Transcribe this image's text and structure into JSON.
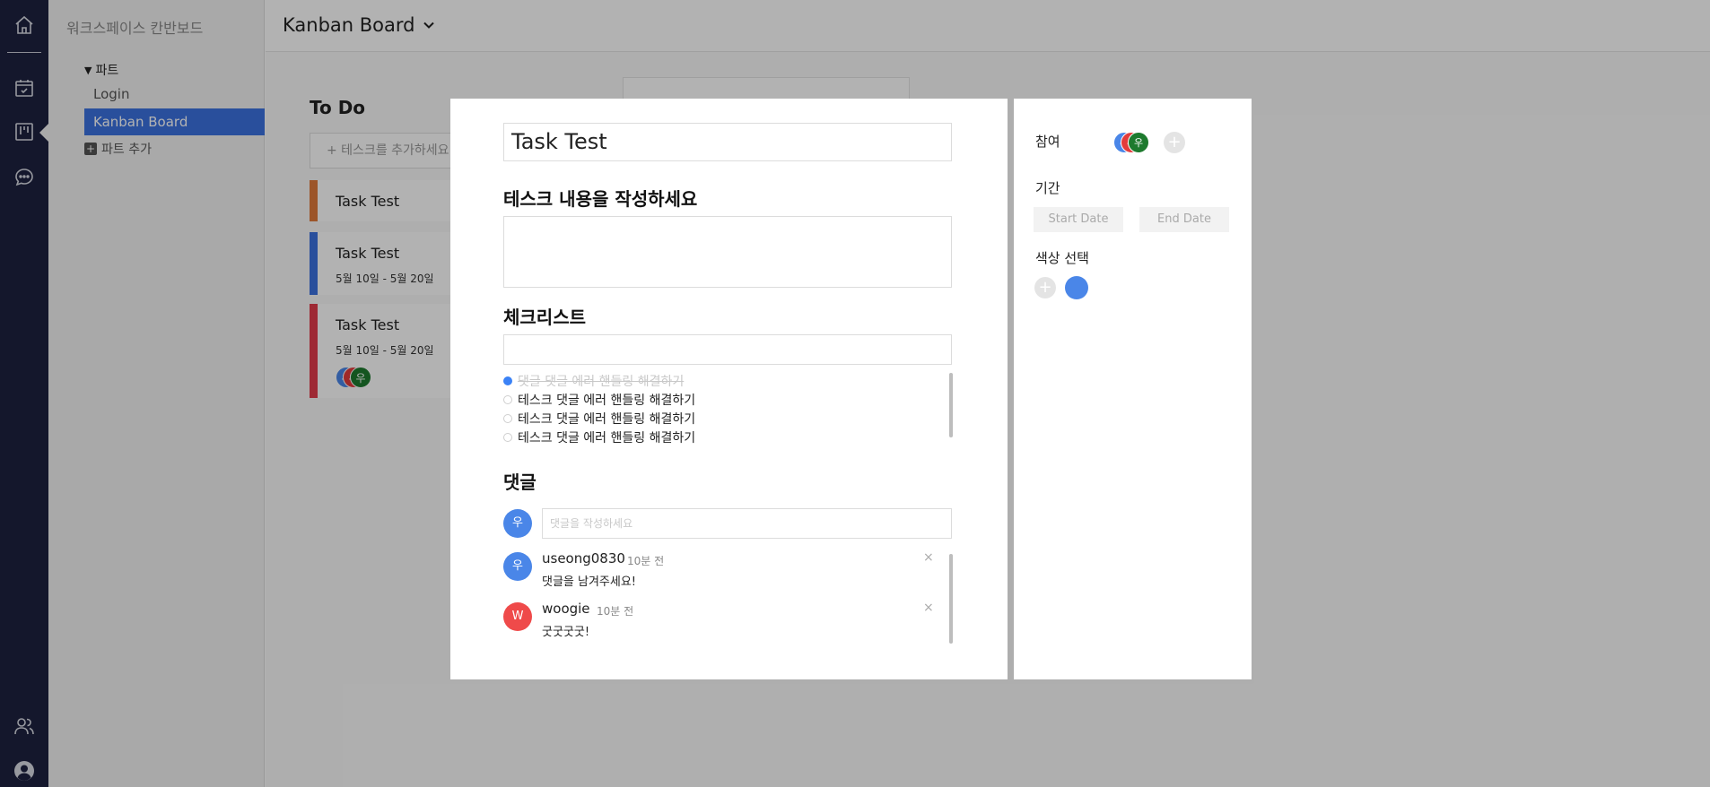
{
  "sidebar": {
    "workspace_title": "워크스페이스 칸반보드",
    "section_label": "파트",
    "items": [
      {
        "label": "Login",
        "active": false
      },
      {
        "label": "Kanban Board",
        "active": true
      }
    ],
    "add_part_label": "파트 추가"
  },
  "board": {
    "title": "Kanban Board",
    "column": {
      "title": "To Do",
      "add_task_label": "+ 테스크를 추가하세요",
      "cards": [
        {
          "title": "Task Test",
          "date": "",
          "color": "#e07a3b"
        },
        {
          "title": "Task Test",
          "date": "5월 10일 - 5월 20일",
          "color": "#3b72e0"
        },
        {
          "title": "Task Test",
          "date": "5월 10일 - 5월 20일",
          "color": "#e23c4b",
          "avatars": [
            "우",
            "우",
            "우"
          ]
        }
      ]
    }
  },
  "modal": {
    "title_value": "Task Test",
    "description_heading": "테스크 내용을 작성하세요",
    "checklist_heading": "체크리스트",
    "checklist": [
      {
        "text": "댓글 댓글 에러 핸들링 해결하기",
        "done": true
      },
      {
        "text": "테스크 댓글 에러 핸들링 해결하기",
        "done": false
      },
      {
        "text": "테스크 댓글 에러 핸들링 해결하기",
        "done": false
      },
      {
        "text": "테스크 댓글 에러 핸들링 해결하기",
        "done": false
      }
    ],
    "comments_heading": "댓글",
    "current_user_initial": "우",
    "comment_placeholder": "댓글을 작성하세요",
    "comments": [
      {
        "initial": "우",
        "user": "useong0830",
        "time": "10분 전",
        "text": "댓글을 남겨주세요!",
        "avatar_color": "#4a86e8"
      },
      {
        "initial": "W",
        "user": "woogie",
        "time": "10분 전",
        "text": "굿굿굿굿!",
        "avatar_color": "#ef4a4a"
      }
    ],
    "close_glyph": "×"
  },
  "side_panel": {
    "participants_label": "참여",
    "participants": [
      {
        "initial": "우",
        "color": "#4a86e8"
      },
      {
        "initial": "우",
        "color": "#e23c3c"
      },
      {
        "initial": "우",
        "color": "#1e7a2e"
      }
    ],
    "period_label": "기간",
    "start_date_label": "Start Date",
    "end_date_label": "End Date",
    "color_label": "색상 선택",
    "selected_color": "#4a86e8"
  },
  "icons": [
    "home-icon",
    "calendar-icon",
    "kanban-icon",
    "chat-icon",
    "team-icon",
    "profile-icon",
    "chevron-down-icon",
    "plus-icon",
    "close-icon"
  ]
}
